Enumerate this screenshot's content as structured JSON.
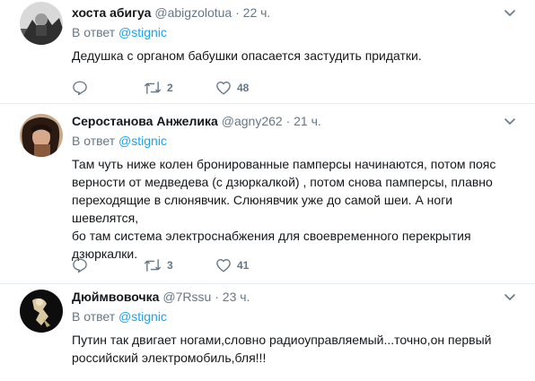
{
  "reply_prefix": "В ответ",
  "tweets": [
    {
      "fullname": "хоста абигуа",
      "handle": "@abigzolotua",
      "separator": "·",
      "time": "22 ч.",
      "reply_to": "@stignic",
      "text": "Дедушка с органом бабушки опасается застудить придатки.",
      "retweets": "2",
      "likes": "48"
    },
    {
      "fullname": "Серостанова Анжелика",
      "handle": "@agny262",
      "separator": "·",
      "time": "21 ч.",
      "reply_to": "@stignic",
      "text": "Там чуть ниже колен бронированные памперсы начинаются, потом пояс\nверности от медведева (с дзюркалкой) , потом снова памперсы, плавно\nпереходящие в слюнявчик. Слюнявчик уже до самой шеи. А ноги шевелятся,\nбо там система электроснабжения для своевременного перекрытия\nдзюркалки.",
      "retweets": "3",
      "likes": "41"
    },
    {
      "fullname": "Дюймвовочка",
      "handle": "@7Rssu",
      "separator": "·",
      "time": "23 ч.",
      "reply_to": "@stignic",
      "text": "Путин так двигает ногами,словно радиоуправляемый...точно,он первый\nроссийский электромобиль,бля!!!"
    }
  ],
  "colors": {
    "link": "#1da1f2",
    "secondary": "#657786",
    "primary_text": "#14171a",
    "divider": "#e6ecf0"
  },
  "icons": {
    "caret": "chevron-down-icon",
    "reply": "reply-icon",
    "retweet": "retweet-icon",
    "like": "heart-icon"
  }
}
